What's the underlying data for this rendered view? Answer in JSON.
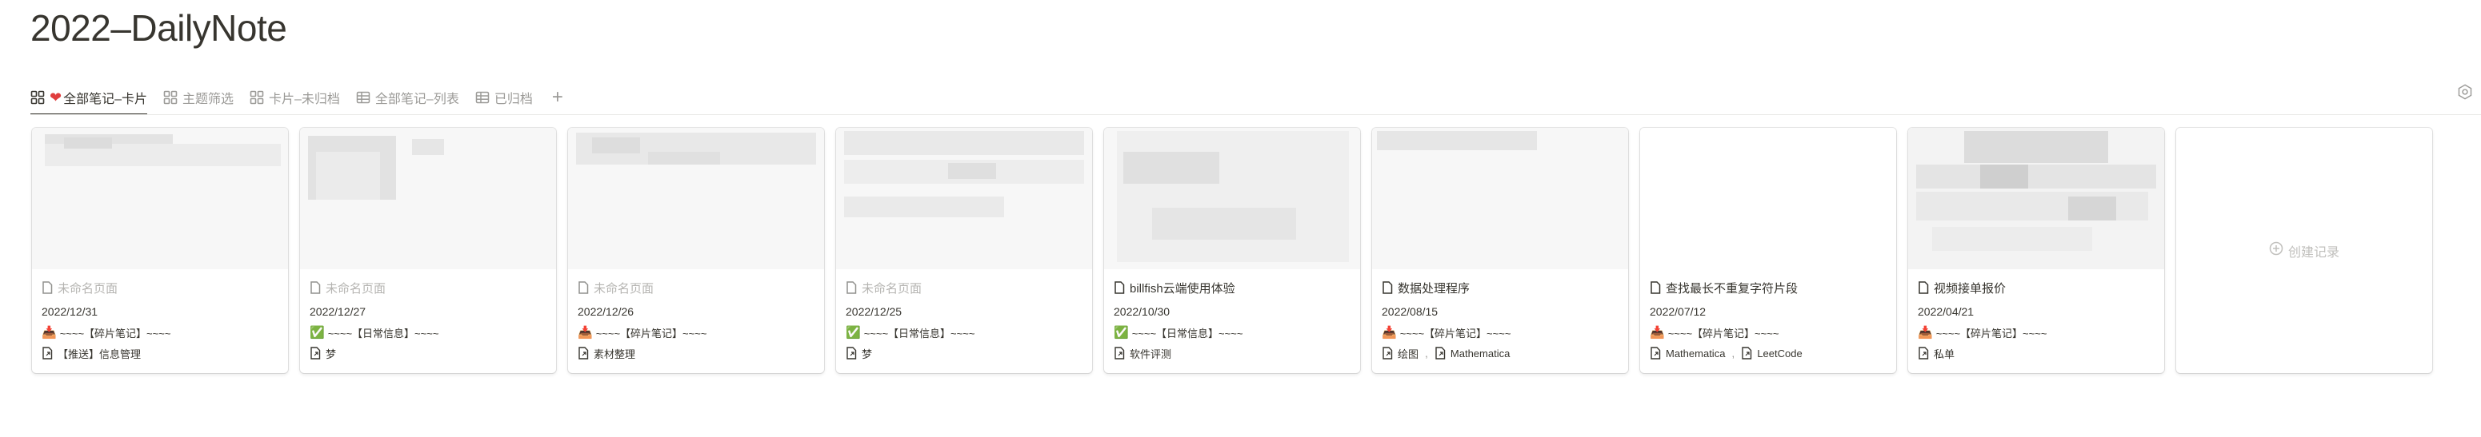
{
  "page": {
    "title": "2022–DailyNote"
  },
  "tabs": [
    {
      "label": "全部笔记–卡片",
      "icon": "gallery-icon",
      "active": true
    },
    {
      "label": "主题筛选",
      "icon": "gallery-icon"
    },
    {
      "label": "卡片–未归档",
      "icon": "gallery-icon"
    },
    {
      "label": "全部笔记–列表",
      "icon": "table-icon"
    },
    {
      "label": "已归档",
      "icon": "table-icon"
    }
  ],
  "add_tab_label": "+",
  "new_record_label": "创建记录",
  "cards": [
    {
      "name": "未命名页面",
      "date": "2022/12/31",
      "category": "~~~~【碎片笔记】~~~~",
      "category_icon": "inbox-tray-icon",
      "tags": [
        "【推送】信息管理"
      ]
    },
    {
      "name": "未命名页面",
      "date": "2022/12/27",
      "category": "~~~~【日常信息】~~~~",
      "category_icon": "check-mark-icon",
      "tags": [
        "梦"
      ]
    },
    {
      "name": "未命名页面",
      "date": "2022/12/26",
      "category": "~~~~【碎片笔记】~~~~",
      "category_icon": "inbox-tray-icon",
      "tags": [
        "素材整理"
      ]
    },
    {
      "name": "未命名页面",
      "date": "2022/12/25",
      "category": "~~~~【日常信息】~~~~",
      "category_icon": "check-mark-icon",
      "tags": [
        "梦"
      ]
    },
    {
      "name": "billfish云端使用体验",
      "date": "2022/10/30",
      "category": "~~~~【日常信息】~~~~",
      "category_icon": "check-mark-icon",
      "tags": [
        "软件评测"
      ]
    },
    {
      "name": "数据处理程序",
      "date": "2022/08/15",
      "category": "~~~~【碎片笔记】~~~~",
      "category_icon": "inbox-tray-icon",
      "tags": [
        "绘图",
        "Mathematica"
      ]
    },
    {
      "name": "查找最长不重复字符片段",
      "date": "2022/07/12",
      "category": "~~~~【碎片笔记】~~~~",
      "category_icon": "inbox-tray-icon",
      "tags": [
        "Mathematica",
        "LeetCode"
      ]
    },
    {
      "name": "视频接单报价",
      "date": "2022/04/21",
      "category": "~~~~【碎片笔记】~~~~",
      "category_icon": "inbox-tray-icon",
      "tags": [
        "私单"
      ]
    }
  ]
}
